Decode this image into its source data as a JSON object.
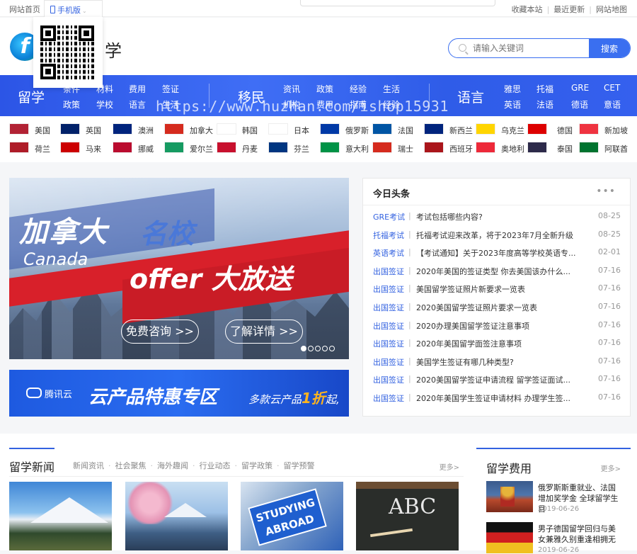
{
  "topbar": {
    "home": "网站首页",
    "mobile": "手机版",
    "links": [
      "收藏本站",
      "最近更新",
      "网站地图"
    ]
  },
  "header": {
    "logo_text": "学",
    "search_placeholder": "请输入关键词",
    "search_button": "搜索"
  },
  "nav": {
    "groups": [
      {
        "title": "留学",
        "items": [
          "条件",
          "材料",
          "费用",
          "签证",
          "政策",
          "学校",
          "语言",
          "生活"
        ]
      },
      {
        "title": "移民",
        "items": [
          "资讯",
          "政策",
          "经验",
          "生活",
          "机构",
          "费用",
          "指南",
          "经验"
        ]
      },
      {
        "title": "语言",
        "items": [
          "雅思",
          "托福",
          "GRE",
          "CET",
          "英语",
          "法语",
          "德语",
          "意语"
        ]
      }
    ]
  },
  "watermark": "https://www.huzhan.com/ishop15931",
  "flags": [
    {
      "name": "美国",
      "color": "#b22234"
    },
    {
      "name": "英国",
      "color": "#012169"
    },
    {
      "name": "澳洲",
      "color": "#00247d"
    },
    {
      "name": "加拿大",
      "color": "#d52b1e"
    },
    {
      "name": "韩国",
      "color": "#ffffff"
    },
    {
      "name": "日本",
      "color": "#ffffff"
    },
    {
      "name": "俄罗斯",
      "color": "#0039a6"
    },
    {
      "name": "法国",
      "color": "#0055a4"
    },
    {
      "name": "新西兰",
      "color": "#00247d"
    },
    {
      "name": "乌克兰",
      "color": "#ffd500"
    },
    {
      "name": "德国",
      "color": "#dd0000"
    },
    {
      "name": "新加坡",
      "color": "#ef3340"
    },
    {
      "name": "荷兰",
      "color": "#ae1c28"
    },
    {
      "name": "马来",
      "color": "#cc0001"
    },
    {
      "name": "挪威",
      "color": "#ba0c2f"
    },
    {
      "name": "爱尔兰",
      "color": "#169b62"
    },
    {
      "name": "丹麦",
      "color": "#c8102e"
    },
    {
      "name": "芬兰",
      "color": "#003580"
    },
    {
      "name": "意大利",
      "color": "#009246"
    },
    {
      "name": "瑞士",
      "color": "#d52b1e"
    },
    {
      "name": "西班牙",
      "color": "#aa151b"
    },
    {
      "name": "奥地利",
      "color": "#ed2939"
    },
    {
      "name": "泰国",
      "color": "#2d2a4a"
    },
    {
      "name": "阿联酋",
      "color": "#00732f"
    }
  ],
  "banner": {
    "title_a": "加拿大",
    "title_b": "名校",
    "subtitle": "Canada",
    "slogan": "offer 大放送",
    "btn_consult": "免费咨询 >>",
    "btn_detail": "了解详情 >>",
    "slides": 5,
    "active_slide": 1
  },
  "ad": {
    "brand": "腾讯云",
    "title": "云产品特惠专区",
    "desc_pre": "多款云产品",
    "desc_highlight": "1折",
    "desc_post": "起,"
  },
  "today": {
    "title": "今日头条",
    "more": "•••",
    "items": [
      {
        "cat": "GRE考试",
        "title": "考试包括哪些内容?",
        "date": "08-25"
      },
      {
        "cat": "托福考试",
        "title": "托福考试迎来改革，将于2023年7月全新升级",
        "date": "08-25"
      },
      {
        "cat": "英语考试",
        "title": "【考试通知】关于2023年度高等学校英语专...",
        "date": "02-01"
      },
      {
        "cat": "出国签证",
        "title": "2020年美国的签证类型 你去美国该办什么...",
        "date": "07-16"
      },
      {
        "cat": "出国签证",
        "title": "美国留学签证照片新要求一览表",
        "date": "07-16"
      },
      {
        "cat": "出国签证",
        "title": "2020美国留学签证照片要求一览表",
        "date": "07-16"
      },
      {
        "cat": "出国签证",
        "title": "2020办理美国留学签证注意事项",
        "date": "07-16"
      },
      {
        "cat": "出国签证",
        "title": "2020年美国留学面签注意事项",
        "date": "07-16"
      },
      {
        "cat": "出国签证",
        "title": "美国学生签证有哪几种类型?",
        "date": "07-16"
      },
      {
        "cat": "出国签证",
        "title": "2020美国留学签证申请流程 留学签证面试...",
        "date": "07-16"
      },
      {
        "cat": "出国签证",
        "title": "2020年美国学生签证申请材料 办理学生签...",
        "date": "07-16"
      }
    ]
  },
  "news": {
    "title": "留学新闻",
    "tabs": [
      "新闻资讯",
      "社会聚焦",
      "海外趣闻",
      "行业动态",
      "留学政策",
      "留学预警"
    ],
    "more": "更多>",
    "thumb3_text": "STUDYING ABROAD",
    "thumb4_text": "ABC"
  },
  "fee": {
    "title": "留学费用",
    "more": "更多>",
    "items": [
      {
        "title": "俄罗斯斯重就业、法国增加奖学金 全球留学生目",
        "date": "2019-06-26"
      },
      {
        "title": "男子德国留学回归与美女兼雅久别重逢相拥无",
        "date": "2019-06-26"
      }
    ]
  }
}
